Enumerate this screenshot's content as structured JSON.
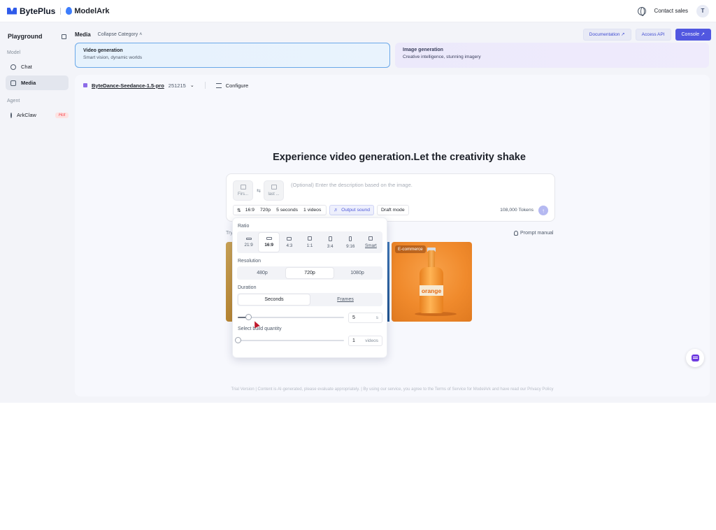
{
  "brand": {
    "name": "BytePlus",
    "product": "ModelArk"
  },
  "topbar": {
    "contact": "Contact sales",
    "avatar": "T"
  },
  "sidebar": {
    "title": "Playground",
    "groups": [
      {
        "label": "Model",
        "items": [
          {
            "label": "Chat"
          },
          {
            "label": "Media",
            "active": true
          }
        ]
      },
      {
        "label": "Agent",
        "items": [
          {
            "label": "ArkClaw",
            "badge": "Hot"
          }
        ]
      }
    ]
  },
  "main": {
    "title": "Media",
    "collapse": "Collapse Category ˄",
    "buttons": {
      "docs": "Documentation ↗",
      "api": "Access API",
      "console": "Console ↗"
    }
  },
  "categories": [
    {
      "title": "Video generation",
      "sub": "Smart vision, dynamic worlds"
    },
    {
      "title": "Image generation",
      "sub": "Creative intelligence, stunning imagery"
    }
  ],
  "model": {
    "name": "ByteDance-Seedance-1.5-pro",
    "version": "251215",
    "configure": "Configure"
  },
  "headline": "Experience video generation.Let the creativity shake",
  "prompt": {
    "first": "Firs...",
    "last": "last ...",
    "placeholder": "(Optional) Enter the description based on the image.",
    "ratio": "16:9",
    "resolution": "720p",
    "duration": "5 seconds",
    "count": "1 videos",
    "sound": "Output sound",
    "draft": "Draft mode",
    "tokens": "108,000 Tokens"
  },
  "try_label": "Try",
  "prompt_manual": "Prompt manual",
  "showcase": {
    "badge": "E-commerce",
    "label_text": "orange"
  },
  "footer": "Trial Version | Content is AI-generated, please evaluate appropriately. | By using our service, you agree to the Terms of Service for ModelArk and have read our Privacy Policy",
  "popover": {
    "ratio_label": "Ratio",
    "ratios": [
      "21:9",
      "16:9",
      "4:3",
      "1:1",
      "3:4",
      "9:16",
      "Smart"
    ],
    "selected_ratio": "16:9",
    "resolution_label": "Resolution",
    "resolutions": [
      "480p",
      "720p",
      "1080p"
    ],
    "selected_resolution": "720p",
    "duration_label": "Duration",
    "duration_tabs": [
      "Seconds",
      "Frames"
    ],
    "duration_value": "5",
    "duration_unit": "s",
    "duration_level": 0.1,
    "quantity_label": "Select build quantity",
    "quantity_value": "1",
    "quantity_unit": "videos",
    "quantity_level": 0
  },
  "colors": {
    "accent": "#5157e0",
    "video_border": "#6aa8e9",
    "hot": "#f5424b"
  }
}
